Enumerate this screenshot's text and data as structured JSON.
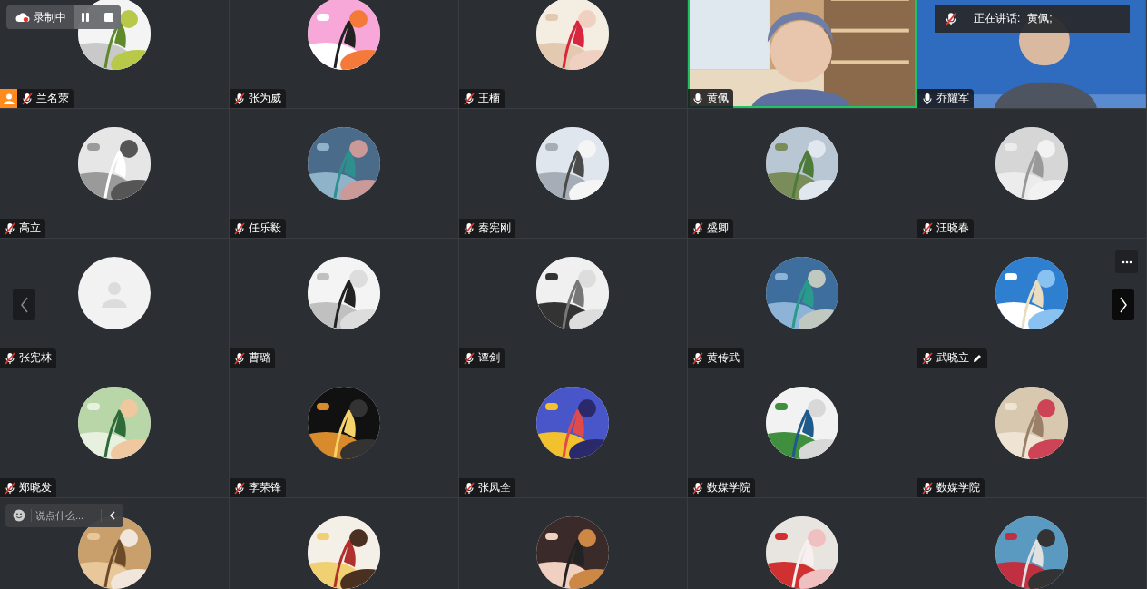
{
  "recording": {
    "label": "录制中"
  },
  "speaking_banner": {
    "label": "正在讲话:",
    "speaker": "黄佩;",
    "mic_muted": true
  },
  "tiles": [
    {
      "name": "兰名荥",
      "kind": "avatar",
      "mic_muted": true,
      "speaking": false,
      "host": true,
      "editing": false
    },
    {
      "name": "张为威",
      "kind": "avatar",
      "mic_muted": true,
      "speaking": false,
      "host": false,
      "editing": false
    },
    {
      "name": "王楠",
      "kind": "avatar",
      "mic_muted": true,
      "speaking": false,
      "host": false,
      "editing": false
    },
    {
      "name": "黄佩",
      "kind": "video",
      "mic_muted": false,
      "speaking": true,
      "host": false,
      "editing": false
    },
    {
      "name": "乔耀军",
      "kind": "video",
      "mic_muted": false,
      "speaking": false,
      "host": false,
      "editing": false
    },
    {
      "name": "高立",
      "kind": "avatar",
      "mic_muted": true,
      "speaking": false,
      "host": false,
      "editing": false
    },
    {
      "name": "任乐毅",
      "kind": "avatar",
      "mic_muted": true,
      "speaking": false,
      "host": false,
      "editing": false
    },
    {
      "name": "秦宪刚",
      "kind": "avatar",
      "mic_muted": true,
      "speaking": false,
      "host": false,
      "editing": false
    },
    {
      "name": "盛卿",
      "kind": "avatar",
      "mic_muted": true,
      "speaking": false,
      "host": false,
      "editing": false
    },
    {
      "name": "汪晓春",
      "kind": "avatar",
      "mic_muted": true,
      "speaking": false,
      "host": false,
      "editing": false
    },
    {
      "name": "张宪林",
      "kind": "default",
      "mic_muted": true,
      "speaking": false,
      "host": false,
      "editing": false
    },
    {
      "name": "曹璐",
      "kind": "avatar",
      "mic_muted": true,
      "speaking": false,
      "host": false,
      "editing": false
    },
    {
      "name": "谭剑",
      "kind": "avatar",
      "mic_muted": true,
      "speaking": false,
      "host": false,
      "editing": false
    },
    {
      "name": "黄传武",
      "kind": "avatar",
      "mic_muted": true,
      "speaking": false,
      "host": false,
      "editing": false
    },
    {
      "name": "武晓立",
      "kind": "avatar",
      "mic_muted": true,
      "speaking": false,
      "host": false,
      "editing": true
    },
    {
      "name": "郑晓发",
      "kind": "avatar",
      "mic_muted": true,
      "speaking": false,
      "host": false,
      "editing": false
    },
    {
      "name": "李荣锋",
      "kind": "avatar",
      "mic_muted": true,
      "speaking": false,
      "host": false,
      "editing": false
    },
    {
      "name": "张凤全",
      "kind": "avatar",
      "mic_muted": true,
      "speaking": false,
      "host": false,
      "editing": false
    },
    {
      "name": "数媒学院",
      "kind": "avatar",
      "mic_muted": true,
      "speaking": false,
      "host": false,
      "editing": false
    },
    {
      "name": "数媒学院",
      "kind": "avatar",
      "mic_muted": true,
      "speaking": false,
      "host": false,
      "editing": false
    },
    {
      "kind": "avatar",
      "speaking": false
    },
    {
      "kind": "avatar",
      "speaking": false
    },
    {
      "kind": "avatar",
      "speaking": false
    },
    {
      "kind": "avatar",
      "speaking": false
    },
    {
      "kind": "avatar",
      "speaking": false
    }
  ],
  "chat": {
    "placeholder": "说点什么..."
  }
}
